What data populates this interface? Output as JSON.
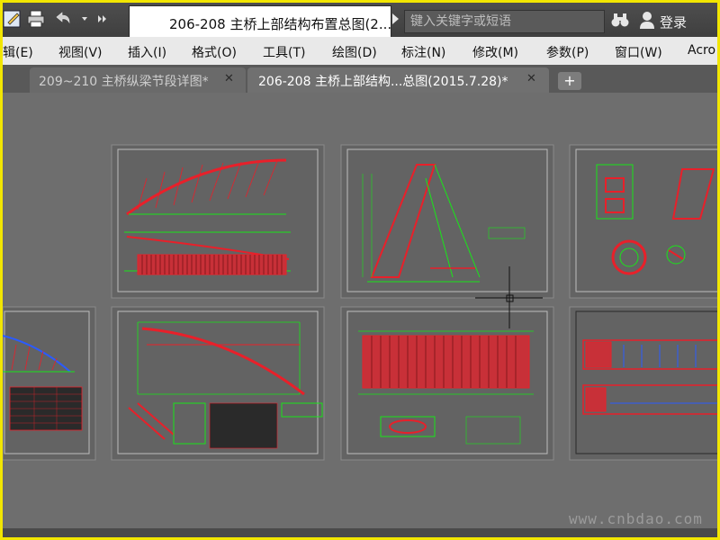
{
  "titlebar": {
    "document_title": "206-208 主桥上部结构布置总图(2...",
    "search_placeholder": "键入关键字或短语",
    "login_label": "登录"
  },
  "menu": {
    "items": [
      "辑(E)",
      "视图(V)",
      "插入(I)",
      "格式(O)",
      "工具(T)",
      "绘图(D)",
      "标注(N)",
      "修改(M)",
      "参数(P)",
      "窗口(W)",
      "Acro"
    ]
  },
  "tabs": [
    {
      "label": "209~210 主桥纵梁节段详图*",
      "close": "✕",
      "active": false
    },
    {
      "label": "206-208 主桥上部结构...总图(2015.7.28)*",
      "close": "✕",
      "active": true
    }
  ],
  "tab_add_label": "+",
  "watermark": "www.cnbdao.com",
  "icons": {
    "save": "save-icon",
    "print": "print-icon",
    "undo": "undo-icon",
    "search": "binoculars-icon",
    "user": "user-icon"
  },
  "colors": {
    "frame": "#f2e600",
    "canvas": "#6e6e6e",
    "drawing_red": "#e8202a",
    "drawing_green": "#19e619"
  }
}
